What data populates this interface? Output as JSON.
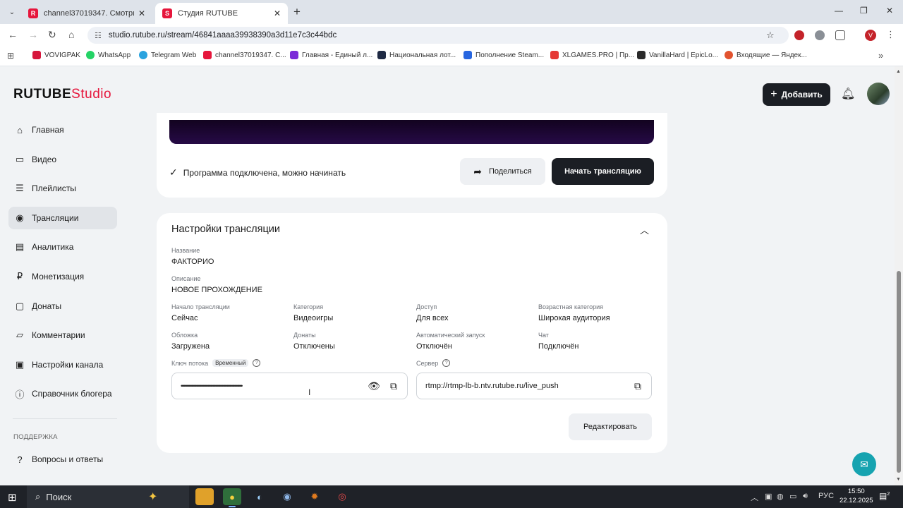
{
  "browser": {
    "tabs": [
      {
        "title": "channel37019347. Смотрите в...",
        "favicon": "R"
      },
      {
        "title": "Студия RUTUBE",
        "favicon": "S"
      }
    ],
    "url": "studio.rutube.ru/stream/46841aaaa39938390a3d11e7c3c44bdc",
    "profile_initial": "V",
    "bookmarks": [
      {
        "label": "VOVIGPAK",
        "color": "#d6163c"
      },
      {
        "label": "WhatsApp",
        "color": "#25d366"
      },
      {
        "label": "Telegram Web",
        "color": "#2aa3df"
      },
      {
        "label": "channel37019347. C...",
        "color": "#e6163c"
      },
      {
        "label": "Главная - Единый л...",
        "color": "#7b2ad8"
      },
      {
        "label": "Национальная лот...",
        "color": "#1f2a44"
      },
      {
        "label": "Пополнение Steam...",
        "color": "#2766e0"
      },
      {
        "label": "XLGAMES.PRO | Пр...",
        "color": "#e53935"
      },
      {
        "label": "VanillaHard | EpicLo...",
        "color": "#2a2a2a"
      },
      {
        "label": "Входящие — Яндек...",
        "color": "#e2532f"
      }
    ]
  },
  "app": {
    "logo_main": "RUTUBE",
    "logo_accent": "Studio",
    "add_button": "Добавить"
  },
  "sidebar": {
    "items": [
      {
        "label": "Главная",
        "icon": "home-icon",
        "glyph": "⌂"
      },
      {
        "label": "Видео",
        "icon": "video-icon",
        "glyph": "▭"
      },
      {
        "label": "Плейлисты",
        "icon": "playlist-icon",
        "glyph": "☰"
      },
      {
        "label": "Трансляции",
        "icon": "broadcast-icon",
        "glyph": "◉"
      },
      {
        "label": "Аналитика",
        "icon": "analytics-icon",
        "glyph": "▤"
      },
      {
        "label": "Монетизация",
        "icon": "monetization-icon",
        "glyph": "₽"
      },
      {
        "label": "Донаты",
        "icon": "donate-icon",
        "glyph": "▢"
      },
      {
        "label": "Комментарии",
        "icon": "comments-icon",
        "glyph": "▱"
      },
      {
        "label": "Настройки канала",
        "icon": "settings-icon",
        "glyph": "▣"
      },
      {
        "label": "Справочник блогера",
        "icon": "info-icon",
        "glyph": "ⓘ"
      }
    ],
    "support_label": "ПОДДЕРЖКА",
    "faq_label": "Вопросы и ответы"
  },
  "stream": {
    "status_text": "Программа подключена, можно начинать",
    "share_label": "Поделиться",
    "start_label": "Начать трансляцию"
  },
  "settings": {
    "title": "Настройки трансляции",
    "name_label": "Название",
    "name_value": "ФАКТОРИО",
    "desc_label": "Описание",
    "desc_value": "НОВОЕ ПРОХОЖДЕНИЕ",
    "grid": [
      {
        "label": "Начало трансляции",
        "value": "Сейчас"
      },
      {
        "label": "Категория",
        "value": "Видеоигры"
      },
      {
        "label": "Доступ",
        "value": "Для всех"
      },
      {
        "label": "Возрастная категория",
        "value": "Широкая аудитория"
      },
      {
        "label": "Обложка",
        "value": "Загружена"
      },
      {
        "label": "Донаты",
        "value": "Отключены"
      },
      {
        "label": "Автоматический запуск",
        "value": "Отключён"
      },
      {
        "label": "Чат",
        "value": "Подключён"
      }
    ],
    "key_label": "Ключ потока",
    "key_badge": "Временный",
    "key_value": "••••••••••••••••••••••••••••••••••••••••••••••••••••••••••••••••",
    "server_label": "Сервер",
    "server_value": "rtmp://rtmp-lb-b.ntv.rutube.ru/live_push",
    "edit_label": "Редактировать"
  },
  "taskbar": {
    "search_label": "Поиск",
    "language": "РУС",
    "time": "15:50",
    "date": "22.12.2025",
    "notifications": "2"
  }
}
